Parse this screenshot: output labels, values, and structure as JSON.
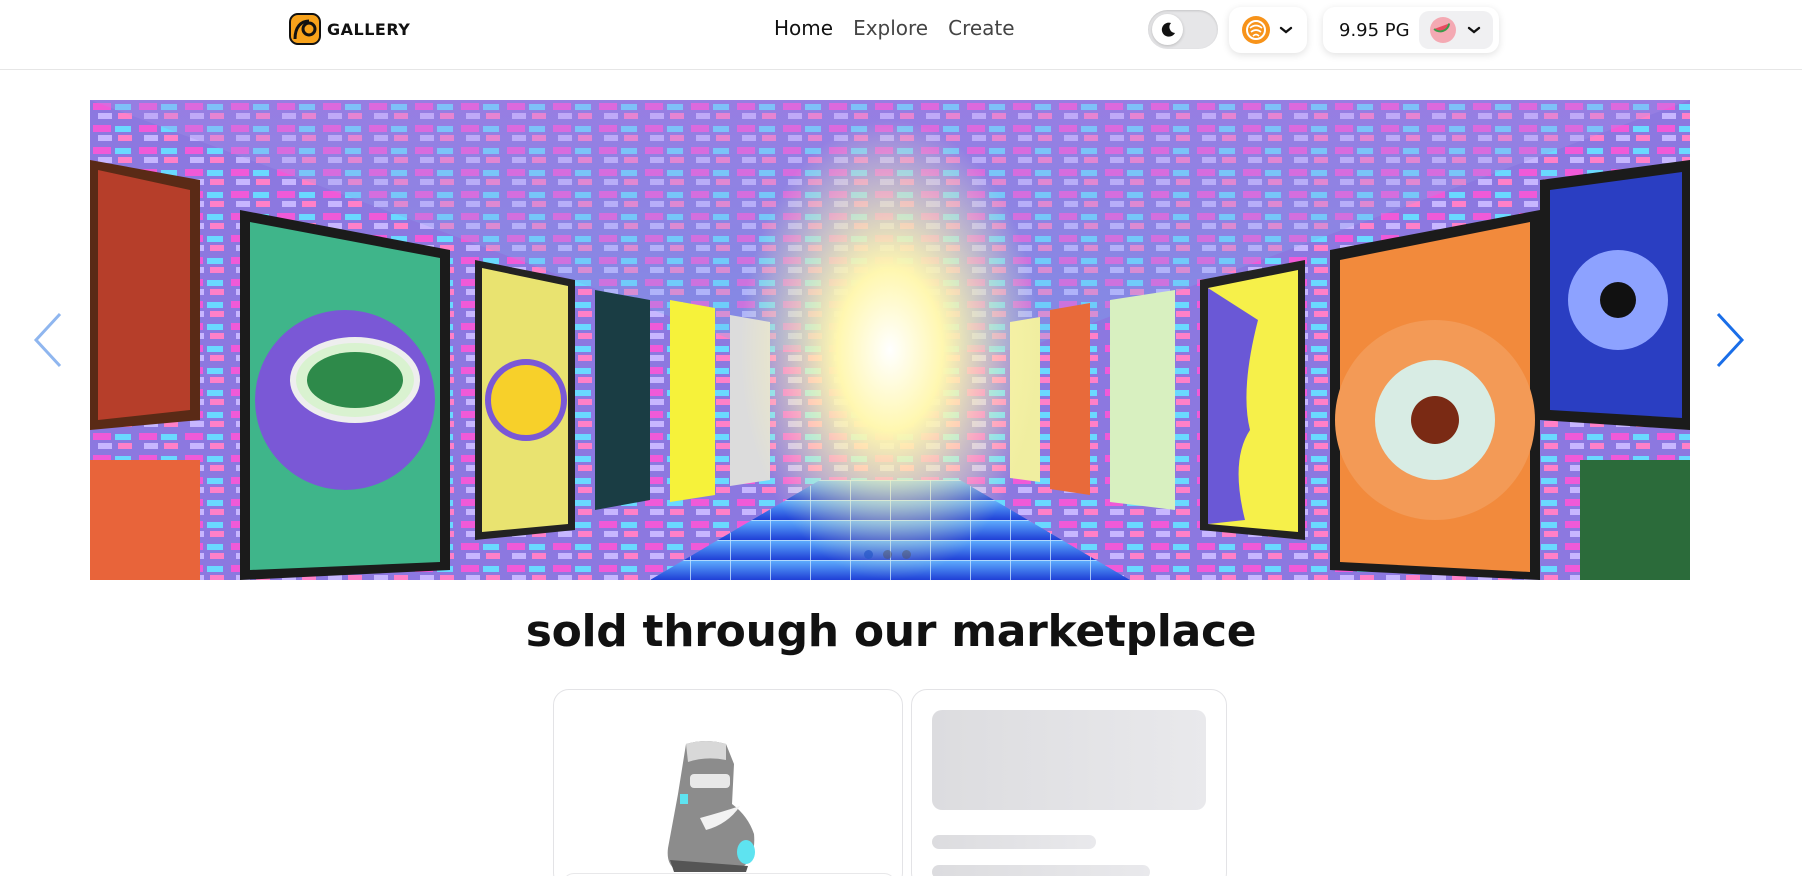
{
  "brand": {
    "name": "GALLERY",
    "logo_color": "#f7a21b"
  },
  "nav": {
    "items": [
      {
        "label": "Home",
        "active": true
      },
      {
        "label": "Explore",
        "active": false
      },
      {
        "label": "Create",
        "active": false
      }
    ]
  },
  "theme_toggle": {
    "mode": "light",
    "icon": "moon-icon"
  },
  "network": {
    "icon": "network-badge-icon",
    "color": "#f7931a"
  },
  "wallet": {
    "balance": "9.95 PG",
    "avatar_icon": "watermelon-avatar-icon"
  },
  "carousel": {
    "slide_count": 3,
    "active_index": 0,
    "slide_description": "Neon NFT gallery corridor artwork",
    "accent": "#1a6ee8"
  },
  "section": {
    "title": "sold through our marketplace"
  },
  "cards": [
    {
      "type": "product",
      "image_icon": "sneaker-image"
    },
    {
      "type": "loading-skeleton"
    }
  ]
}
